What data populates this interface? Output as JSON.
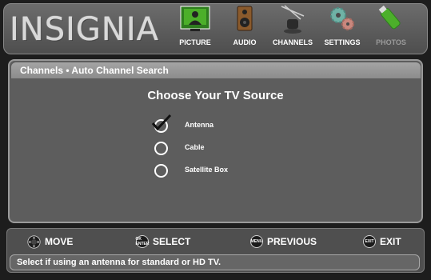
{
  "brand": {
    "logo_text": "INSIGNIA"
  },
  "menu": [
    {
      "label": "PICTURE",
      "icon": "picture-icon"
    },
    {
      "label": "AUDIO",
      "icon": "speaker-icon"
    },
    {
      "label": "CHANNELS",
      "icon": "antenna-icon"
    },
    {
      "label": "SETTINGS",
      "icon": "gears-icon"
    },
    {
      "label": "PHOTOS",
      "icon": "usb-drive-icon"
    }
  ],
  "breadcrumb": "Channels • Auto Channel Search",
  "heading": "Choose Your TV Source",
  "options": [
    {
      "label": "Antenna",
      "selected": true
    },
    {
      "label": "Cable",
      "selected": false
    },
    {
      "label": "Satellite Box",
      "selected": false
    }
  ],
  "hints": [
    {
      "icon": "dpad-icon",
      "button_text": "",
      "label": "MOVE"
    },
    {
      "icon": "ok-enter-button-icon",
      "button_text": "OK ENTER",
      "label": "SELECT"
    },
    {
      "icon": "menu-button-icon",
      "button_text": "MENU",
      "label": "PREVIOUS"
    },
    {
      "icon": "exit-button-icon",
      "button_text": "EXIT",
      "label": "EXIT"
    }
  ],
  "status_text": "Select if using an antenna for standard or HD TV.",
  "colors": {
    "background": "#1d1d1d",
    "panel": "#5d5d5d",
    "selection_green": "#4caf2a",
    "text": "#ffffff",
    "disabled_text": "#9a9a9a"
  }
}
